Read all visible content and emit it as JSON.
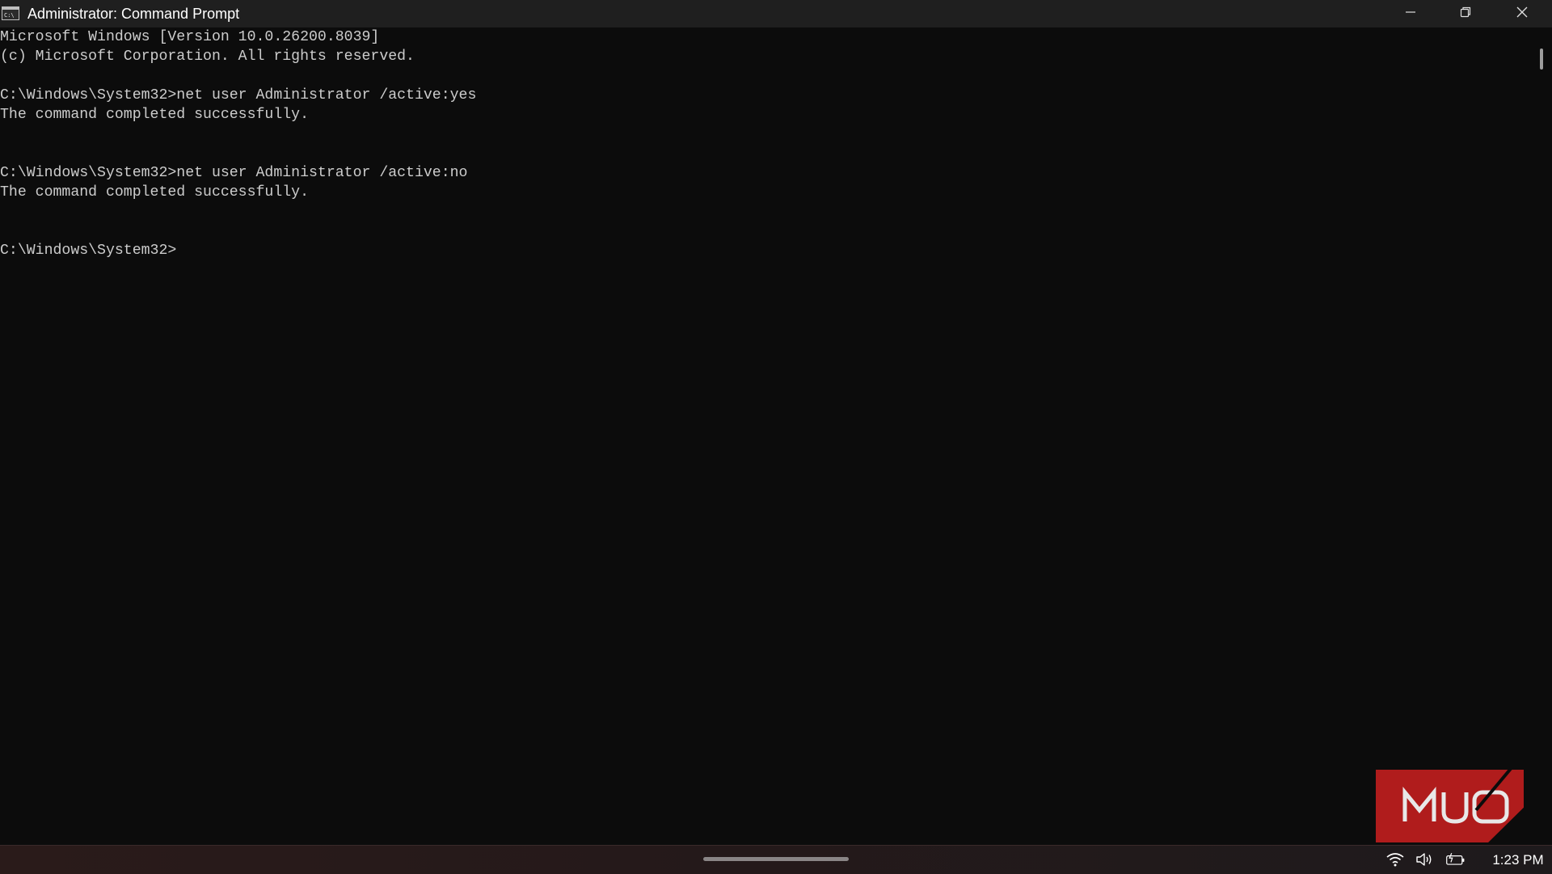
{
  "window": {
    "title": "Administrator: Command Prompt",
    "icons": {
      "app": "command-prompt-icon",
      "minimize": "minimize-icon",
      "maximize": "restore-icon",
      "close": "close-icon"
    }
  },
  "console": {
    "lines": [
      "Microsoft Windows [Version 10.0.26200.8039]",
      "(c) Microsoft Corporation. All rights reserved.",
      "",
      "C:\\Windows\\System32>net user Administrator /active:yes",
      "The command completed successfully.",
      "",
      "",
      "C:\\Windows\\System32>net user Administrator /active:no",
      "The command completed successfully.",
      "",
      "",
      "C:\\Windows\\System32>"
    ]
  },
  "taskbar": {
    "time": "1:23 PM",
    "icons": [
      "wifi-icon",
      "volume-icon",
      "battery-icon"
    ]
  },
  "colors": {
    "console_bg": "#0c0c0c",
    "console_text": "#cccccc",
    "titlebar_bg": "#1f1f1f",
    "watermark_red": "#b01c1c"
  }
}
